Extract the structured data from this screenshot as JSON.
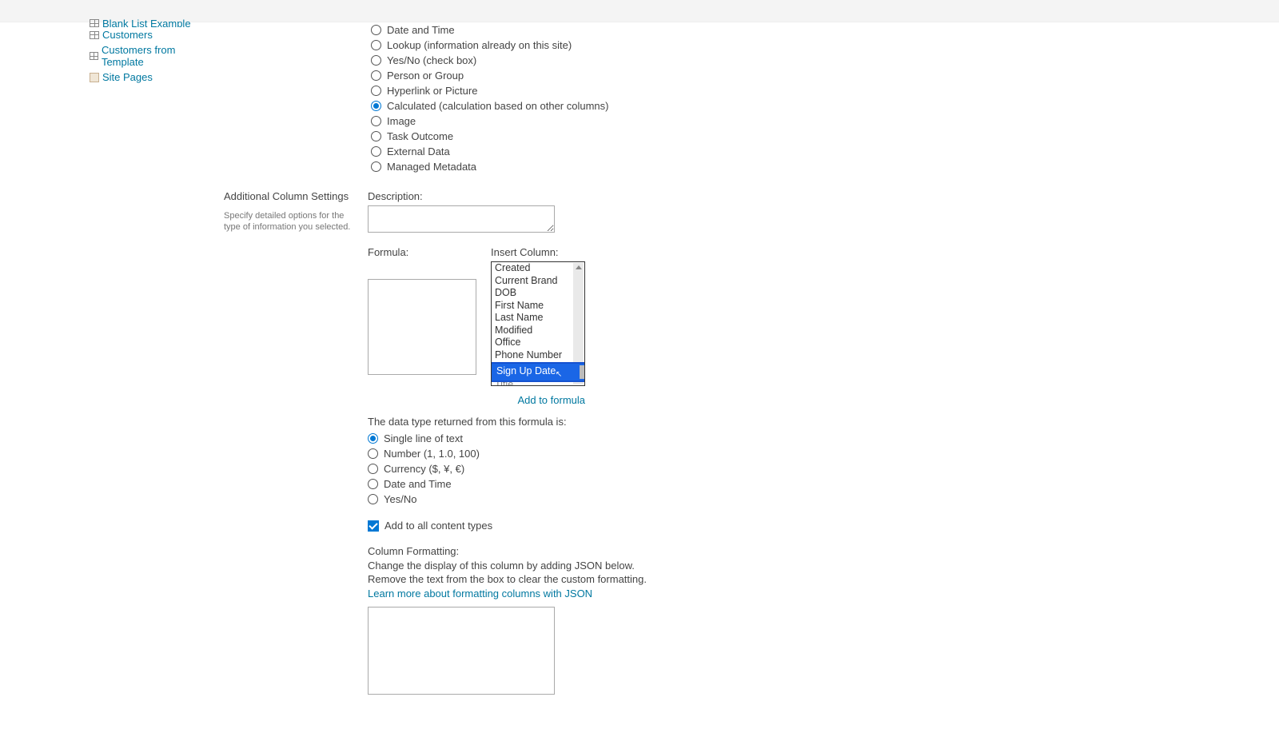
{
  "sidebar": {
    "items": [
      {
        "label": "Blank List Example",
        "icon": "list"
      },
      {
        "label": "Customers",
        "icon": "list"
      },
      {
        "label": "Customers from Template",
        "icon": "list"
      },
      {
        "label": "Site Pages",
        "icon": "page"
      }
    ]
  },
  "columnTypes": {
    "truncated": "Currency ($, ¥, €)",
    "options": [
      {
        "label": "Date and Time",
        "checked": false
      },
      {
        "label": "Lookup (information already on this site)",
        "checked": false
      },
      {
        "label": "Yes/No (check box)",
        "checked": false
      },
      {
        "label": "Person or Group",
        "checked": false
      },
      {
        "label": "Hyperlink or Picture",
        "checked": false
      },
      {
        "label": "Calculated (calculation based on other columns)",
        "checked": true
      },
      {
        "label": "Image",
        "checked": false
      },
      {
        "label": "Task Outcome",
        "checked": false
      },
      {
        "label": "External Data",
        "checked": false
      },
      {
        "label": "Managed Metadata",
        "checked": false
      }
    ]
  },
  "additional": {
    "title": "Additional Column Settings",
    "desc": "Specify detailed options for the type of information you selected.",
    "descriptionLabel": "Description:",
    "formulaLabel": "Formula:",
    "insertColLabel": "Insert Column:",
    "insertColumns": [
      "Created",
      "Current Brand",
      "DOB",
      "First Name",
      "Last Name",
      "Modified",
      "Office",
      "Phone Number",
      "Sign Up Date",
      "Title"
    ],
    "selectedInsert": "Sign Up Date",
    "addToFormula": "Add to formula",
    "returnLabel": "The data type returned from this formula is:",
    "returnOptions": [
      {
        "label": "Single line of text",
        "checked": true
      },
      {
        "label": "Number (1, 1.0, 100)",
        "checked": false
      },
      {
        "label": "Currency ($, ¥, €)",
        "checked": false
      },
      {
        "label": "Date and Time",
        "checked": false
      },
      {
        "label": "Yes/No",
        "checked": false
      }
    ],
    "addAllContentTypes": "Add to all content types"
  },
  "columnFormatting": {
    "title": "Column Formatting:",
    "line1": "Change the display of this column by adding JSON below.",
    "line2": "Remove the text from the box to clear the custom formatting.",
    "learn": "Learn more about formatting columns with JSON"
  }
}
